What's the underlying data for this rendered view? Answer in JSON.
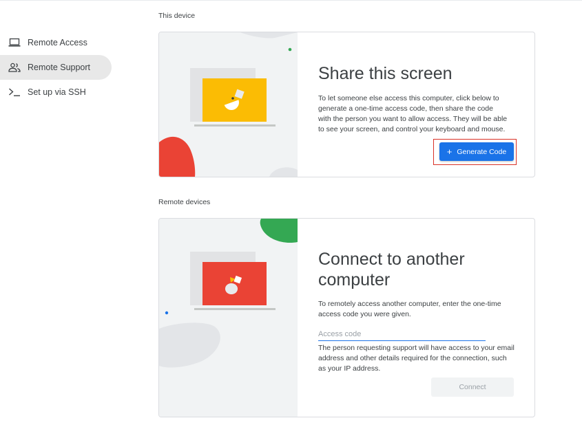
{
  "sidebar": {
    "items": [
      {
        "label": "Remote Access",
        "icon": "laptop-icon",
        "active": false
      },
      {
        "label": "Remote Support",
        "icon": "people-icon",
        "active": true
      },
      {
        "label": "Set up via SSH",
        "icon": "terminal-icon",
        "active": false
      }
    ]
  },
  "this_device": {
    "section_label": "This device",
    "title": "Share this screen",
    "body": "To let someone else access this computer, click below to generate a one-time access code, then share the code with the person you want to allow access. They will be able to see your screen, and control your keyboard and mouse.",
    "button_label": "Generate Code",
    "button_icon": "plus-icon"
  },
  "remote_devices": {
    "section_label": "Remote devices",
    "title_line1": "Connect to another",
    "title_line2": "computer",
    "body": "To remotely access another computer, enter the one-time access code you were given.",
    "input_placeholder": "Access code",
    "input_value": "",
    "note": "The person requesting support will have access to your email address and other details required for the connection, such as your IP address.",
    "connect_label": "Connect"
  },
  "colors": {
    "accent": "#1a73e8",
    "highlight": "#d93025",
    "yellow": "#fbbc04",
    "red": "#ea4335",
    "green": "#34a853",
    "active_nav": "#e8e8e8"
  }
}
